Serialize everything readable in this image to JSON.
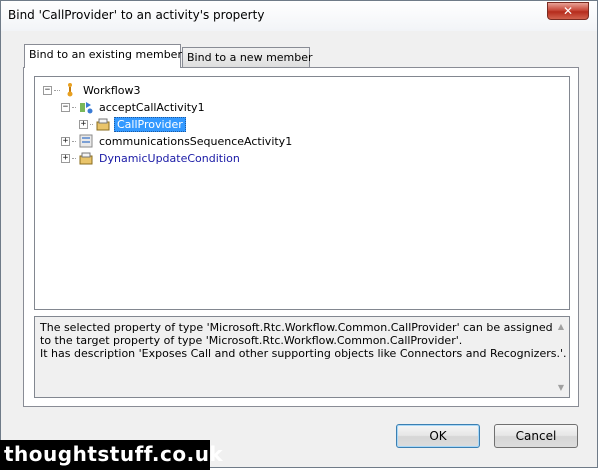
{
  "window": {
    "title": "Bind 'CallProvider' to an activity's property",
    "close_glyph": "✕"
  },
  "tabs": [
    {
      "label": "Bind to an existing member",
      "active": true
    },
    {
      "label": "Bind to a new member",
      "active": false
    }
  ],
  "tree": {
    "root": "Workflow3",
    "items": [
      {
        "label": "acceptCallActivity1"
      },
      {
        "label": "CallProvider",
        "selected": true
      },
      {
        "label": "communicationsSequenceActivity1"
      },
      {
        "label": "DynamicUpdateCondition"
      }
    ]
  },
  "description": {
    "line1": "The selected property of type 'Microsoft.Rtc.Workflow.Common.CallProvider' can be assigned",
    "line2": "to the target property of type 'Microsoft.Rtc.Workflow.Common.CallProvider'.",
    "line3": "It has description 'Exposes Call and other supporting objects like Connectors and Recognizers.'."
  },
  "buttons": {
    "ok": "OK",
    "cancel": "Cancel"
  },
  "watermark": "thoughtstuff.co.uk",
  "colors": {
    "selection": "#3399ff",
    "property_text": "#1a1aa6",
    "close_button": "#c8493a"
  },
  "icons": [
    "workflow-icon",
    "activity-icon",
    "property-icon"
  ]
}
